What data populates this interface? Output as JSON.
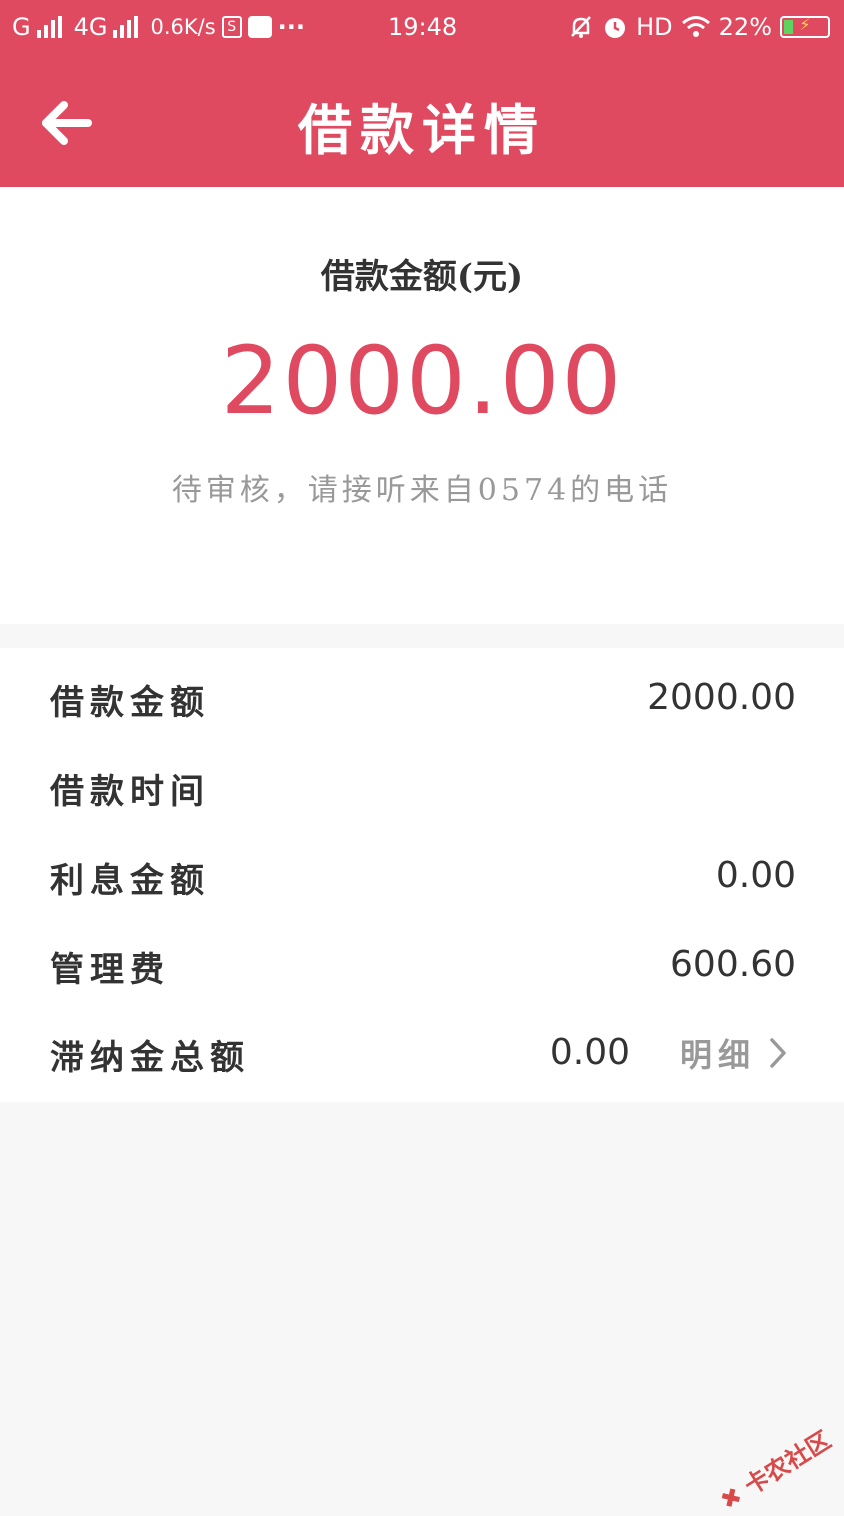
{
  "status_bar": {
    "carrier1": "G",
    "carrier2": "4G",
    "speed": "0.6K/s",
    "box_icon_text": "S",
    "dots": "···",
    "time": "19:48",
    "hd": "HD",
    "battery": "22%",
    "battery_level": 0.22
  },
  "header": {
    "title": "借款详情",
    "bg_color": "#e04a60"
  },
  "summary": {
    "label": "借款金额(元)",
    "amount": "2000.00",
    "status": "待审核，请接听来自0574的电话",
    "amount_color": "#e04a60"
  },
  "details": {
    "rows": [
      {
        "label": "借款金额",
        "value": "2000.00"
      },
      {
        "label": "借款时间",
        "value": ""
      },
      {
        "label": "利息金额",
        "value": "0.00"
      },
      {
        "label": "管理费",
        "value": "600.60"
      },
      {
        "label": "滞纳金总额",
        "value": "0.00",
        "link": "明细"
      }
    ]
  },
  "watermark": "卡农社区"
}
